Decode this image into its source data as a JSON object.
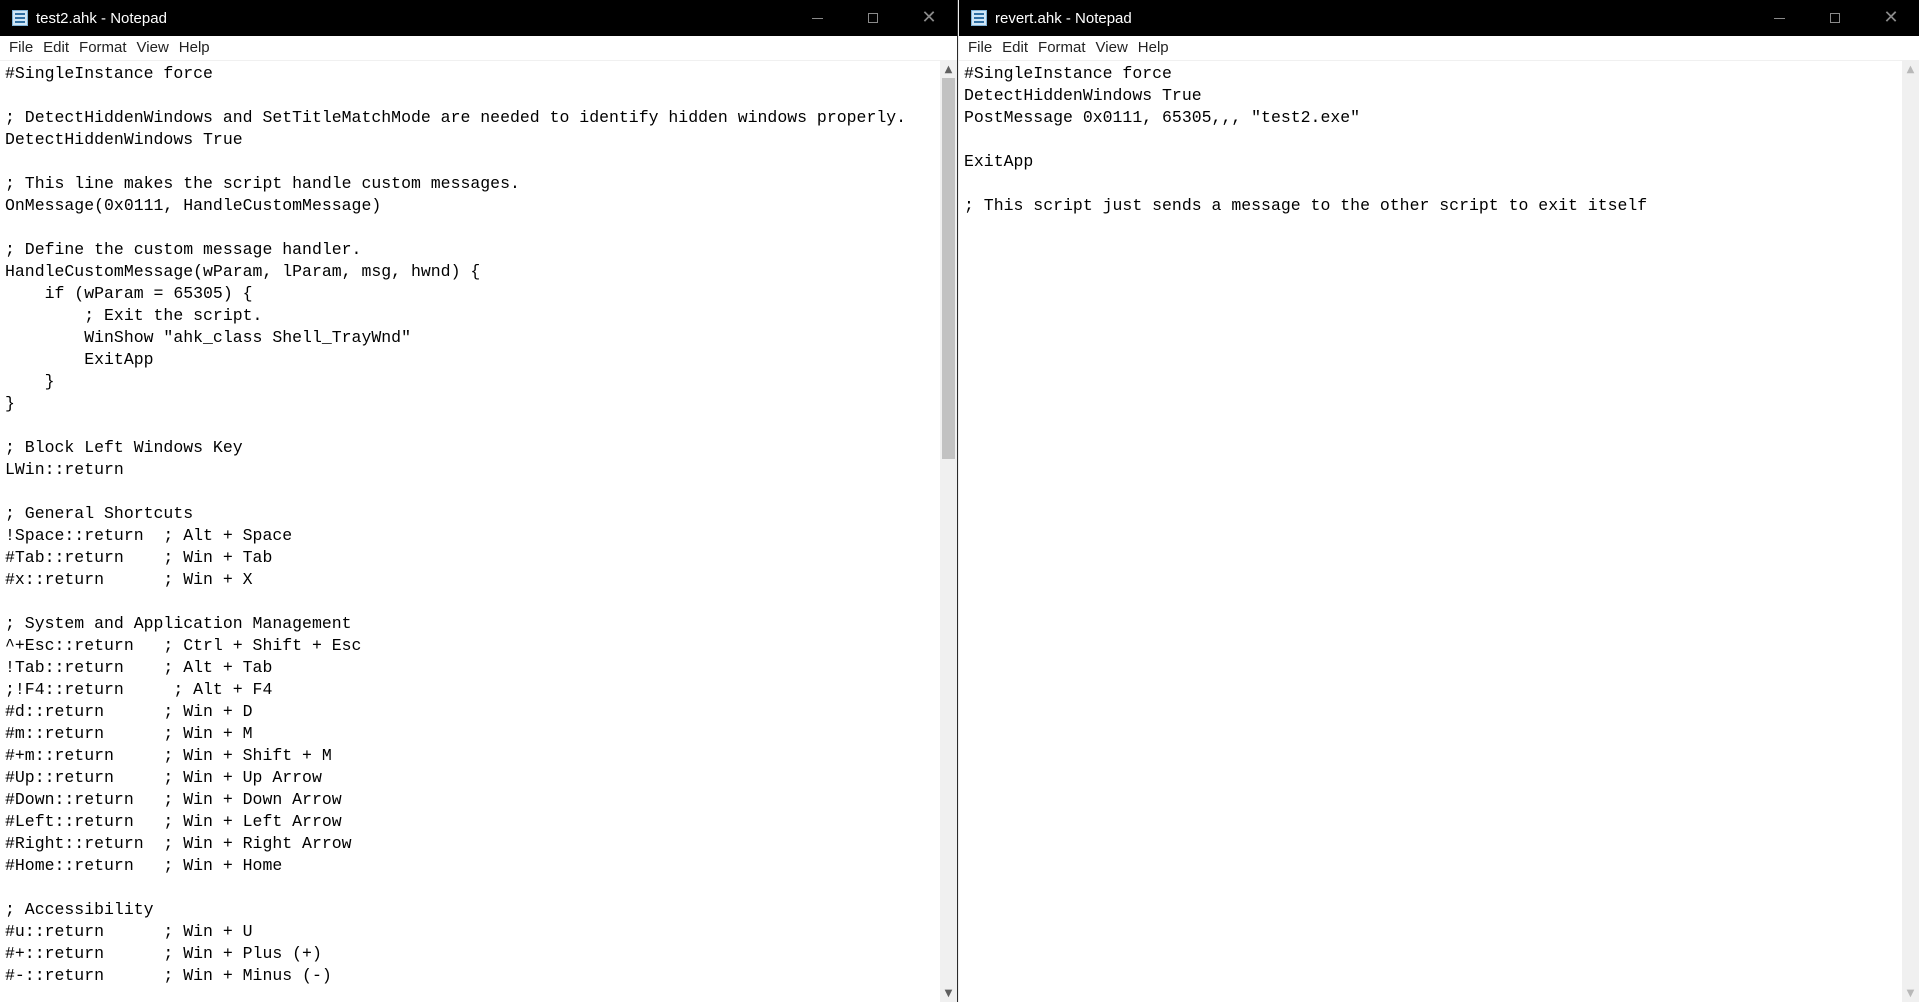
{
  "menu": [
    "File",
    "Edit",
    "Format",
    "View",
    "Help"
  ],
  "windows": [
    {
      "title": "test2.ahk - Notepad",
      "lines": [
        "#SingleInstance force",
        "",
        "; DetectHiddenWindows and SetTitleMatchMode are needed to identify hidden windows properly.",
        "DetectHiddenWindows True",
        "",
        "; This line makes the script handle custom messages.",
        "OnMessage(0x0111, HandleCustomMessage)",
        "",
        "; Define the custom message handler.",
        "HandleCustomMessage(wParam, lParam, msg, hwnd) {",
        "    if (wParam = 65305) {",
        "        ; Exit the script.",
        "        WinShow \"ahk_class Shell_TrayWnd\"",
        "        ExitApp",
        "    }",
        "}",
        "",
        "; Block Left Windows Key",
        "LWin::return",
        "",
        "; General Shortcuts",
        "!Space::return  ; Alt + Space",
        "#Tab::return    ; Win + Tab",
        "#x::return      ; Win + X",
        "",
        "; System and Application Management",
        "^+Esc::return   ; Ctrl + Shift + Esc",
        "!Tab::return    ; Alt + Tab",
        ";!F4::return     ; Alt + F4",
        "#d::return      ; Win + D",
        "#m::return      ; Win + M",
        "#+m::return     ; Win + Shift + M",
        "#Up::return     ; Win + Up Arrow",
        "#Down::return   ; Win + Down Arrow",
        "#Left::return   ; Win + Left Arrow",
        "#Right::return  ; Win + Right Arrow",
        "#Home::return   ; Win + Home",
        "",
        "; Accessibility",
        "#u::return      ; Win + U",
        "#+::return      ; Win + Plus (+)",
        "#-::return      ; Win + Minus (-)"
      ],
      "scroll": {
        "thumb_fraction": 0.42
      }
    },
    {
      "title": "revert.ahk - Notepad",
      "lines": [
        "#SingleInstance force",
        "DetectHiddenWindows True",
        "PostMessage 0x0111, 65305,,, \"test2.exe\"",
        "",
        "ExitApp",
        "",
        "; This script just sends a message to the other script to exit itself"
      ],
      "scroll": {
        "thumb_fraction": 0
      }
    }
  ]
}
